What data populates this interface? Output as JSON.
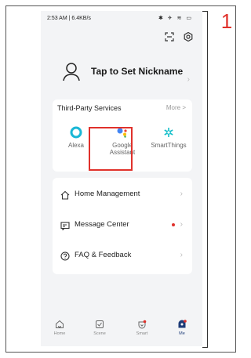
{
  "step_number": "1",
  "status_bar": {
    "time_speed": "2:53 AM | 6.4KB/s",
    "icons": "✱ ✈ ≋ ▭"
  },
  "profile": {
    "nickname": "Tap to Set Nickname"
  },
  "services": {
    "title": "Third-Party Services",
    "more": "More >",
    "items": [
      {
        "label": "Alexa"
      },
      {
        "label": "Google Assistant"
      },
      {
        "label": "SmartThings"
      }
    ]
  },
  "menu": {
    "items": [
      {
        "label": "Home Management"
      },
      {
        "label": "Message Center"
      },
      {
        "label": "FAQ & Feedback"
      }
    ]
  },
  "tabs": [
    {
      "label": "Home"
    },
    {
      "label": "Scene"
    },
    {
      "label": "Smart"
    },
    {
      "label": "Me"
    }
  ],
  "colors": {
    "accent": "#1e3c78",
    "highlight": "#e0312b"
  }
}
